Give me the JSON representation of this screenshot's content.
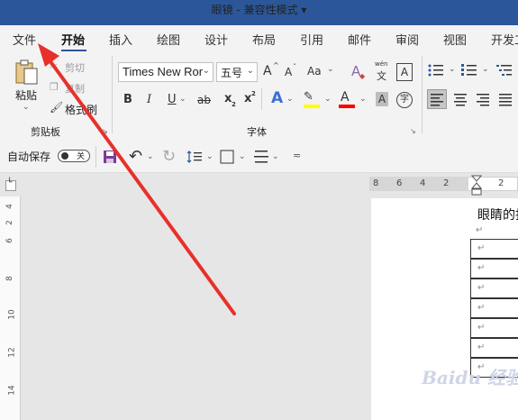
{
  "titlebar": {
    "title": "眼镜  -  兼容性模式 ▾"
  },
  "tabs": [
    {
      "label": "文件"
    },
    {
      "label": "开始"
    },
    {
      "label": "插入"
    },
    {
      "label": "绘图"
    },
    {
      "label": "设计"
    },
    {
      "label": "布局"
    },
    {
      "label": "引用"
    },
    {
      "label": "邮件"
    },
    {
      "label": "审阅"
    },
    {
      "label": "视图"
    },
    {
      "label": "开发工"
    }
  ],
  "clipboard": {
    "paste_label": "粘贴",
    "cut_label": "剪切",
    "copy_label": "复制",
    "format_painter_label": "格式刷",
    "group_label": "剪贴板"
  },
  "font": {
    "font_name": "Times New Ror",
    "font_size": "五号",
    "grow_label": "A",
    "shrink_label": "A",
    "case_label": "Aa",
    "phonetic_top": "wén",
    "phonetic_bottom": "文",
    "border_label": "A",
    "bold_label": "B",
    "italic_label": "I",
    "underline_label": "U",
    "strike_label": "ab",
    "subscript_label": "x",
    "superscript_label": "x",
    "effects_label": "A",
    "highlight_label": "ab",
    "font_color_label": "A",
    "shading_label": "A",
    "enclose_label": "字",
    "group_label": "字体"
  },
  "qat": {
    "autosave_label": "自动保存",
    "toggle_label": "关"
  },
  "ruler": {
    "h_ticks": [
      "8",
      "6",
      "4",
      "2",
      "2"
    ],
    "v_ticks": [
      "4",
      "2",
      "6",
      "8",
      "10",
      "12",
      "14"
    ]
  },
  "document": {
    "heading_text": "眼睛的抗",
    "para_mark": "↵",
    "table_rows": 7
  },
  "watermark": {
    "text": "Baidu 经验"
  },
  "colors": {
    "brand": "#2b579a",
    "highlight": "#ffff00",
    "font_color": "#ff0000",
    "arrow": "#e8302a"
  }
}
